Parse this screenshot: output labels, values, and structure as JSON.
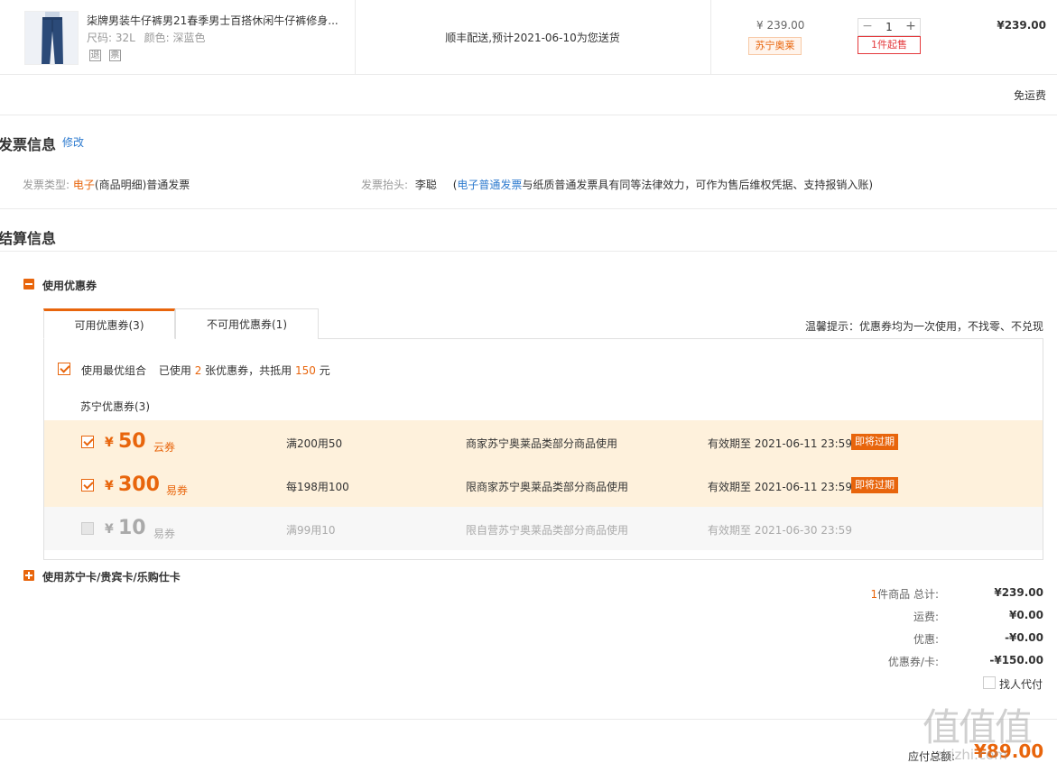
{
  "product": {
    "title": "柒牌男装牛仔裤男21春季男士百搭休闲牛仔裤修身...",
    "size_label": "尺码:",
    "size": "32L",
    "color_label": "颜色:",
    "color": "深蓝色",
    "tag_return": "退",
    "tag_invoice": "票",
    "delivery": "顺丰配送,预计2021-06-10为您送货",
    "unit_price": "¥ 239.00",
    "store": "苏宁奥莱",
    "quantity": "1",
    "qty_minus": "−",
    "qty_plus": "+",
    "min_sale": "1件起售",
    "subtotal": "¥239.00",
    "shipping": "免运费"
  },
  "invoice": {
    "title": "发票信息",
    "edit": "修改",
    "type_label": "发票类型:",
    "type_highlight": "电子",
    "type_rest": "(商品明细)普通发票",
    "header_label": "发票抬头:",
    "header_value": "李聪",
    "note_open": "(",
    "note_link": "电子普通发票",
    "note_rest": "与纸质普通发票具有同等法律效力，可作为售后维权凭据、支持报销入账)"
  },
  "settlement": {
    "title": "结算信息",
    "use_coupon": "使用优惠券",
    "tabs": [
      {
        "label": "可用优惠券(3)"
      },
      {
        "label": "不可用优惠券(1)"
      }
    ],
    "tip": "温馨提示：优惠券均为一次使用，不找零、不兑现",
    "best_combo": "使用最优组合",
    "used_prefix": "已使用",
    "used_count": "2",
    "used_mid": "张优惠券，共抵用",
    "used_amount": "150",
    "used_suffix": "元",
    "group_title": "苏宁优惠券(3)",
    "coupons": [
      {
        "yen": "¥",
        "amount": "50",
        "type": "云券",
        "rule": "满200用50",
        "scope": "商家苏宁奥莱品类部分商品使用",
        "valid": "有效期至 2021-06-11 23:59",
        "badge": "即将过期"
      },
      {
        "yen": "¥",
        "amount": "300",
        "type": "易券",
        "rule": "每198用100",
        "scope": "限商家苏宁奥莱品类部分商品使用",
        "valid": "有效期至 2021-06-11 23:59",
        "badge": "即将过期"
      },
      {
        "yen": "¥",
        "amount": "10",
        "type": "易券",
        "rule": "满99用10",
        "scope": "限自营苏宁奥莱品类部分商品使用",
        "valid": "有效期至 2021-06-30 23:59"
      }
    ],
    "use_card": "使用苏宁卡/贵宾卡/乐购仕卡"
  },
  "summary": {
    "item_count": "1",
    "item_label": "件商品 总计:",
    "total": "¥239.00",
    "freight_label": "运费:",
    "freight": "¥0.00",
    "discount_label": "优惠:",
    "discount": "-¥0.00",
    "coupon_label": "优惠券/卡:",
    "coupon": "-¥150.00",
    "proxy_pay": "找人代付",
    "payable_label": "应付总额:",
    "payable": "¥89.00"
  },
  "watermark": {
    "main": "值值值",
    "sub": "zhizhi.com"
  },
  "colors": {
    "accent": "#e8650c",
    "link": "#2e7bcf",
    "coupon_bg": "#fef1dc",
    "alert": "#e4393c"
  }
}
